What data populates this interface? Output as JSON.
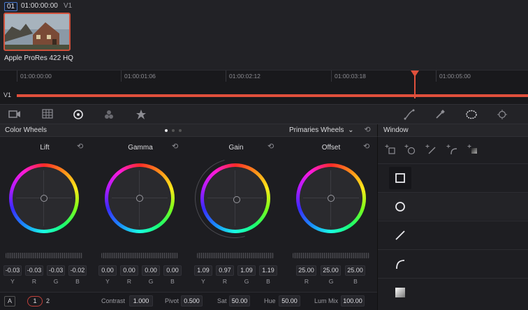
{
  "clip": {
    "number": "01",
    "timecode": "01:00:00:00",
    "track": "V1",
    "codec_label": "Apple ProRes 422 HQ"
  },
  "timeline": {
    "ticks": [
      "01:00:00:00",
      "01:00:01:06",
      "01:00:02:12",
      "01:00:03:18",
      "01:00:05:00"
    ],
    "track_label": "V1"
  },
  "toolbar": {
    "left_icons": [
      "camera-raw-icon",
      "color-match-icon",
      "color-wheels-icon",
      "rgb-mixer-icon",
      "motion-effects-icon"
    ],
    "right_icons": [
      "curves-icon",
      "qualifier-icon",
      "window-icon",
      "tracker-icon"
    ]
  },
  "color_wheels": {
    "title": "Color Wheels",
    "mode": "Primaries Wheels",
    "channel_labels": [
      "Y",
      "R",
      "G",
      "B"
    ],
    "wheels": [
      {
        "name": "Lift",
        "values": [
          "-0.03",
          "-0.03",
          "-0.03",
          "-0.02"
        ]
      },
      {
        "name": "Gamma",
        "values": [
          "0.00",
          "0.00",
          "0.00",
          "0.00"
        ]
      },
      {
        "name": "Gain",
        "values": [
          "1.09",
          "0.97",
          "1.09",
          "1.19"
        ]
      },
      {
        "name": "Offset",
        "values": [
          "25.00",
          "25.00",
          "25.00"
        ]
      }
    ]
  },
  "bottom": {
    "a_label": "A",
    "page1": "1",
    "page2": "2",
    "contrast_label": "Contrast",
    "contrast_value": "1.000",
    "pivot_label": "Pivot",
    "pivot_value": "0.500",
    "sat_label": "Sat",
    "sat_value": "50.00",
    "hue_label": "Hue",
    "hue_value": "50.00",
    "lummix_label": "Lum Mix",
    "lummix_value": "100.00"
  },
  "window": {
    "title": "Window",
    "tools": [
      "add-rectangle-icon",
      "add-circle-icon",
      "add-linear-icon",
      "add-curve-icon",
      "add-gradient-icon"
    ],
    "shapes": [
      "square-window-icon",
      "circle-window-icon",
      "linear-window-icon",
      "curve-window-icon",
      "gradient-window-icon"
    ]
  },
  "colors": {
    "accent": "#e0503c",
    "selected_border": "#4a7bd0"
  }
}
